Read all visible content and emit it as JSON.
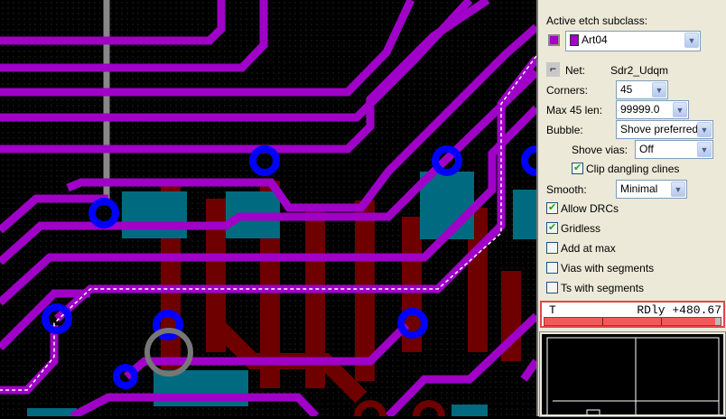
{
  "panel": {
    "active_etch_label": "Active etch subclass:",
    "subclass_value": "Art04",
    "subclass_color": "#a000c8",
    "net_label": "Net:",
    "net_value": "Sdr2_Udqm",
    "corners_label": "Corners:",
    "corners_value": "45",
    "max45_label": "Max 45 len:",
    "max45_value": "99999.0",
    "bubble_label": "Bubble:",
    "bubble_value": "Shove preferred",
    "shove_vias_label": "Shove vias:",
    "shove_vias_value": "Off",
    "smooth_label": "Smooth:",
    "smooth_value": "Minimal",
    "checkboxes": [
      {
        "label": "Clip dangling clines",
        "checked": true
      },
      {
        "label": "Allow DRCs",
        "checked": true
      },
      {
        "label": "Gridless",
        "checked": true
      },
      {
        "label": "Add at max",
        "checked": false
      },
      {
        "label": "Vias with segments",
        "checked": false
      },
      {
        "label": "Ts with segments",
        "checked": false
      }
    ]
  },
  "status": {
    "mode": "T",
    "readout": "RDly +480.67"
  },
  "colors": {
    "trace": "#a000c8",
    "via": "#0000ff",
    "pad": "#006b80",
    "inner": "#6e0000"
  }
}
